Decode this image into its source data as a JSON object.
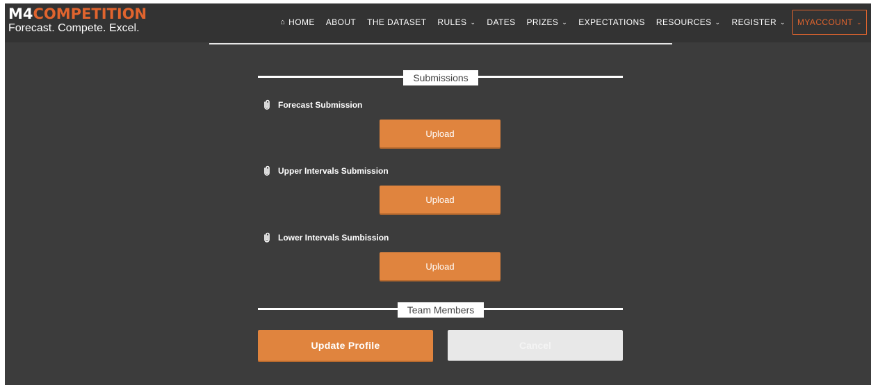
{
  "brand": {
    "logo_prefix": "M4",
    "logo_suffix": "COMPETITION",
    "tagline": "Forecast. Compete. Excel."
  },
  "nav": {
    "home": "HOME",
    "about": "ABOUT",
    "dataset": "THE DATASET",
    "rules": "RULES",
    "dates": "DATES",
    "prizes": "PRIZES",
    "expectations": "EXPECTATIONS",
    "resources": "RESOURCES",
    "register": "REGISTER",
    "myaccount": "MYACCOUNT",
    "icons": {
      "home": "home-icon",
      "dropdown": "chevron-down-icon"
    }
  },
  "submissions": {
    "title": "Submissions",
    "fields": [
      {
        "label": "Forecast Submission",
        "button": "Upload"
      },
      {
        "label": "Upper Intervals Submission",
        "button": "Upload"
      },
      {
        "label": "Lower Intervals Sumbission",
        "button": "Upload"
      }
    ]
  },
  "team": {
    "title": "Team Members"
  },
  "actions": {
    "update": "Update Profile",
    "cancel": "Cancel"
  },
  "colors": {
    "accent": "#e0642e",
    "button": "#e0843e",
    "background": "#3c3c3c",
    "header": "#333333"
  }
}
